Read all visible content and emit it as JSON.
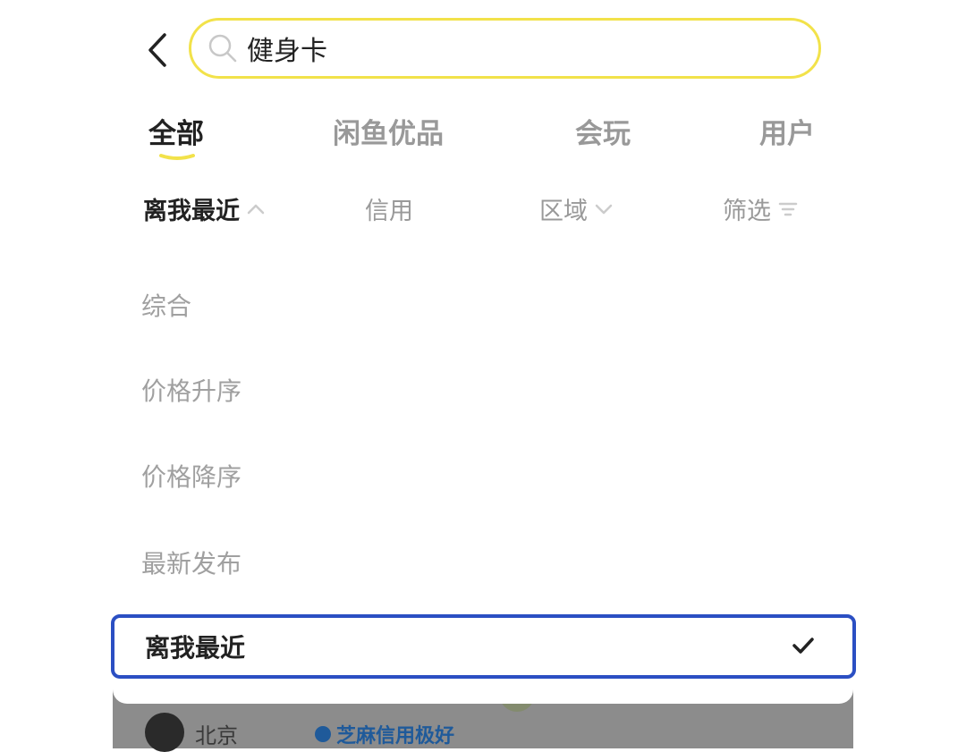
{
  "search": {
    "value": "健身卡"
  },
  "tabs": [
    {
      "label": "全部",
      "active": true
    },
    {
      "label": "闲鱼优品",
      "active": false
    },
    {
      "label": "会玩",
      "active": false
    },
    {
      "label": "用户",
      "active": false
    }
  ],
  "sortbar": [
    {
      "label": "离我最近",
      "icon": "chevron-up-icon",
      "active": true
    },
    {
      "label": "信用",
      "icon": "",
      "active": false
    },
    {
      "label": "区域",
      "icon": "chevron-down-icon",
      "active": false
    },
    {
      "label": "筛选",
      "icon": "filter-icon",
      "active": false
    }
  ],
  "sort_options": [
    {
      "label": "综合"
    },
    {
      "label": "价格升序"
    },
    {
      "label": "价格降序"
    },
    {
      "label": "最新发布"
    },
    {
      "label": "离我最近",
      "selected": true
    }
  ],
  "background_item": {
    "city": "北京",
    "credit": "芝麻信用极好"
  },
  "colors": {
    "accent": "#f2e24a",
    "selection_border": "#2b4fc3"
  }
}
